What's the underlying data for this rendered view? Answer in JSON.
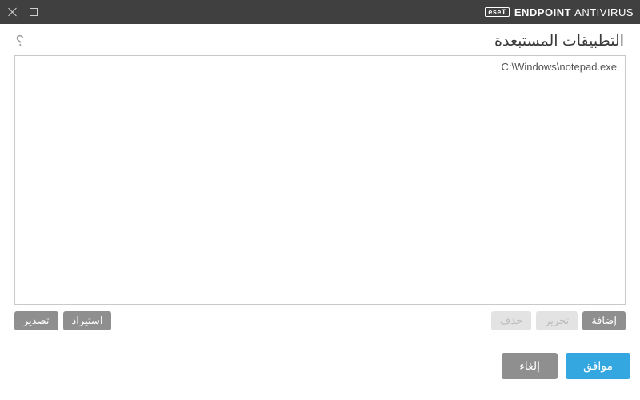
{
  "titlebar": {
    "brand_box": "eseT",
    "brand_bold": "ENDPOINT",
    "brand_light": "ANTIVIRUS"
  },
  "header": {
    "title": "التطبيقات المستبعدة"
  },
  "list": {
    "items": [
      "C:\\Windows\\notepad.exe"
    ]
  },
  "toolbar": {
    "add": "إضافة",
    "edit": "تحرير",
    "delete": "حذف",
    "import": "استيراد",
    "export": "تصدير"
  },
  "footer": {
    "ok": "موافق",
    "cancel": "إلغاء"
  }
}
